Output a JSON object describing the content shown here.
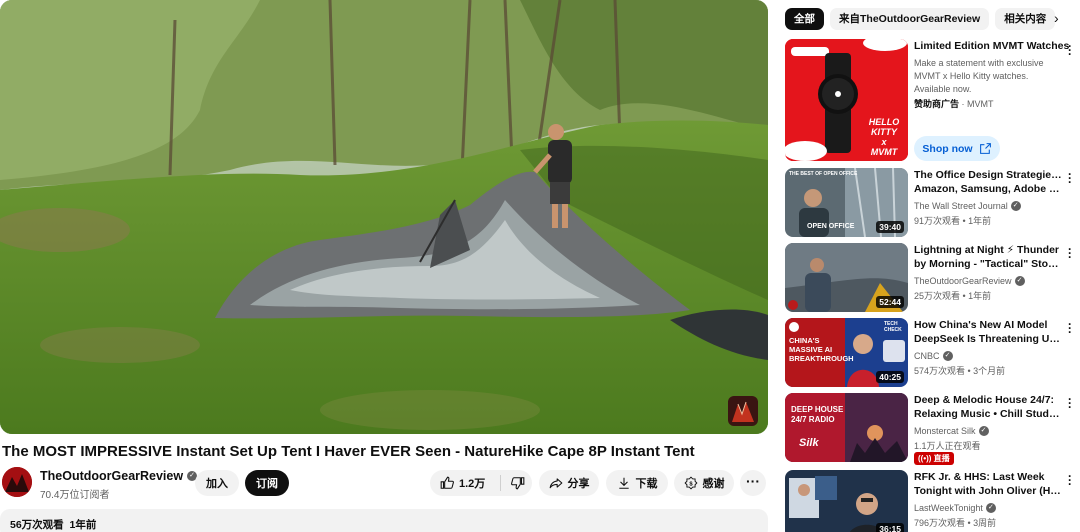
{
  "video": {
    "title": "The MOST IMPRESSIVE Instant Set Up Tent I Haver EVER Seen - NatureHike Cape 8P Instant Tent",
    "channel": "TheOutdoorGearReview",
    "subscribers": "70.4万位订阅者",
    "join_label": "加入",
    "subscribe_label": "订阅",
    "likes": "1.2万",
    "share_label": "分享",
    "download_label": "下载",
    "thanks_label": "感谢",
    "views": "56万次观看",
    "age": "1年前"
  },
  "chips": [
    {
      "label": "全部",
      "active": true
    },
    {
      "label": "来自TheOutdoorGearReview",
      "active": false
    },
    {
      "label": "相关内容",
      "active": false
    }
  ],
  "ad": {
    "title": "Limited Edition MVMT Watches",
    "description": "Make a statement with exclusive MVMT x Hello Kitty watches. Available now.",
    "sponsor_label": "赞助商广告",
    "sponsor_name": "MVMT",
    "shop_label": "Shop now",
    "thumb_text": [
      "HELLO",
      "KITTY",
      "x",
      "MVMT"
    ]
  },
  "recommendations": [
    {
      "title_line1": "The Office Design Strategies of",
      "title_line2": "Amazon, Samsung, Adobe and...",
      "channel": "The Wall Street Journal",
      "verified": true,
      "meta": "91万次观看 • 1年前",
      "duration": "39:40",
      "thumb_text": "OPEN OFFICE",
      "thumb_caption": "THE BEST OF OPEN OFFICE"
    },
    {
      "title_line1": "Lightning at Night ⚡ Thunder",
      "title_line2": "by Morning - \"Tactical\" Storm...",
      "channel": "TheOutdoorGearReview",
      "verified": true,
      "meta": "25万次观看 • 1年前",
      "duration": "52:44"
    },
    {
      "title_line1": "How China's New AI Model",
      "title_line2": "DeepSeek Is Threatening U.S....",
      "channel": "CNBC",
      "verified": true,
      "meta": "574万次观看 • 3个月前",
      "duration": "40:25",
      "thumb_text": "CHINA'S MASSIVE AI BREAKTHROUGH",
      "thumb_badge": "TECH CHECK"
    },
    {
      "title_line1": "Deep & Melodic House 24/7:",
      "title_line2": "Relaxing Music • Chill Study...",
      "channel": "Monstercat Silk",
      "verified": true,
      "meta": "1.1万人正在观看",
      "live_label": "((•)) 直播",
      "thumb_text": "DEEP HOUSE 24/7 RADIO",
      "thumb_brand": "Silk"
    },
    {
      "title_line1": "RFK Jr. & HHS: Last Week",
      "title_line2": "Tonight with John Oliver (HBO)",
      "channel": "LastWeekTonight",
      "verified": true,
      "meta": "796万次观看 • 3周前",
      "duration": "36:15"
    }
  ]
}
